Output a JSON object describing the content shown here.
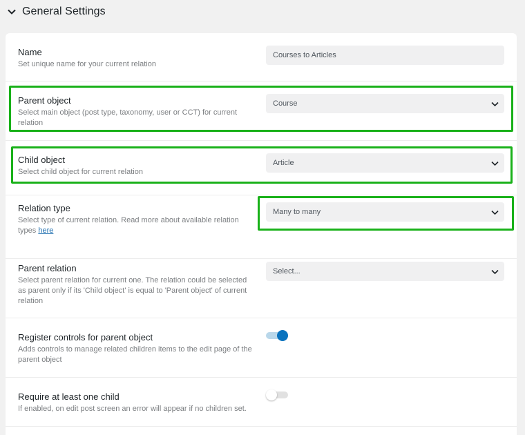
{
  "section": {
    "title": "General Settings",
    "icon": "chevron-down-icon"
  },
  "fields": {
    "name": {
      "label": "Name",
      "description": "Set unique name for your current relation",
      "value": "Courses to Articles"
    },
    "parent_object": {
      "label": "Parent object",
      "description": "Select main object (post type, taxonomy, user or CCT) for current relation",
      "value": "Course"
    },
    "child_object": {
      "label": "Child object",
      "description": "Select child object for current relation",
      "value": "Article"
    },
    "relation_type": {
      "label": "Relation type",
      "description": "Select type of current relation. Read more about available relation types",
      "link_text": "here",
      "value": "Many to many"
    },
    "parent_relation": {
      "label": "Parent relation",
      "description": "Select parent relation for current one. The relation could be selected as parent only if its 'Child object' is equal to 'Parent object' of current relation",
      "placeholder": "Select..."
    },
    "register_controls": {
      "label": "Register controls for parent object",
      "description": "Adds controls to manage related children items to the edit page of the parent object",
      "enabled": true
    },
    "require_child": {
      "label": "Require at least one child",
      "description": "If enabled, on edit post screen an error will appear if no children set.",
      "enabled": false
    }
  },
  "colors": {
    "highlight": "#19b119",
    "toggle_on": "#0a73be",
    "link": "#2271b1"
  }
}
